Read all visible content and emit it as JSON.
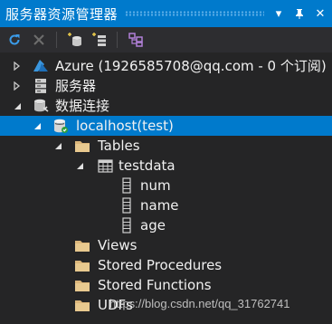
{
  "window": {
    "title": "服务器资源管理器",
    "pin_glyph": "▾",
    "close_glyph": "✕"
  },
  "toolbar": {
    "icons": [
      "refresh-icon",
      "stop-icon",
      "connect-database-icon",
      "connect-server-icon",
      "sharepoint-icon"
    ]
  },
  "tree": {
    "azure": {
      "label": "Azure (1926585708@qq.com - 0 个订阅)",
      "icon": "azure-icon"
    },
    "servers": {
      "label": "服务器",
      "icon": "server-icon"
    },
    "data_connections": {
      "label": "数据连接",
      "icon": "data-connection-icon"
    },
    "connection": {
      "label": "localhost(test)",
      "icon": "database-icon"
    },
    "tables": {
      "label": "Tables",
      "icon": "folder-icon"
    },
    "table": {
      "label": "testdata",
      "icon": "table-icon"
    },
    "columns": [
      {
        "label": "num",
        "icon": "column-icon"
      },
      {
        "label": "name",
        "icon": "column-icon"
      },
      {
        "label": "age",
        "icon": "column-icon"
      }
    ],
    "views": {
      "label": "Views",
      "icon": "folder-icon"
    },
    "stored_procedures": {
      "label": "Stored Procedures",
      "icon": "folder-icon"
    },
    "stored_functions": {
      "label": "Stored Functions",
      "icon": "folder-icon"
    },
    "udfs": {
      "label": "UDFs",
      "icon": "folder-icon"
    }
  },
  "watermark": "https://blog.csdn.net/qq_31762741",
  "colors": {
    "accent": "#007acc",
    "background": "#252526",
    "text": "#f1f1f1",
    "folder": "#dcb67a"
  }
}
